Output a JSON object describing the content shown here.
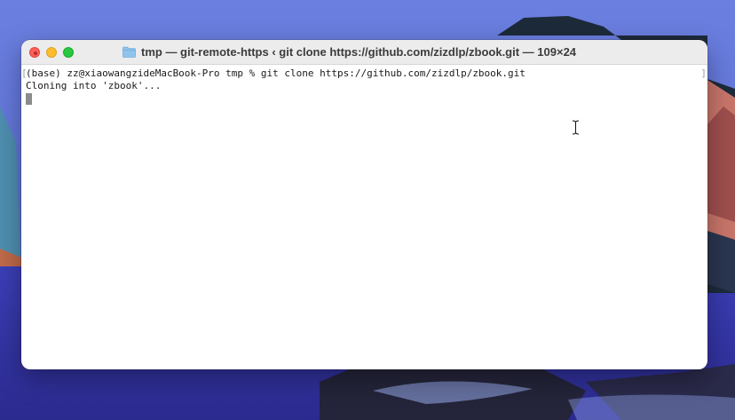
{
  "window": {
    "title": "tmp — git-remote-https ‹ git clone https://github.com/zizdlp/zbook.git — 109×24"
  },
  "terminal": {
    "lines": [
      "(base) zz@xiaowangzideMacBook-Pro tmp % git clone https://github.com/zizdlp/zbook.git",
      "Cloning into 'zbook'..."
    ],
    "bracket_left": "[",
    "bracket_right": "]"
  },
  "colors": {
    "close": "#ff5f57",
    "minimize": "#febc2e",
    "maximize": "#28c840",
    "folder": "#8fc4ec"
  },
  "icons": {
    "title_icon": "folder-icon",
    "mouse_pointer": "text-cursor-icon"
  }
}
